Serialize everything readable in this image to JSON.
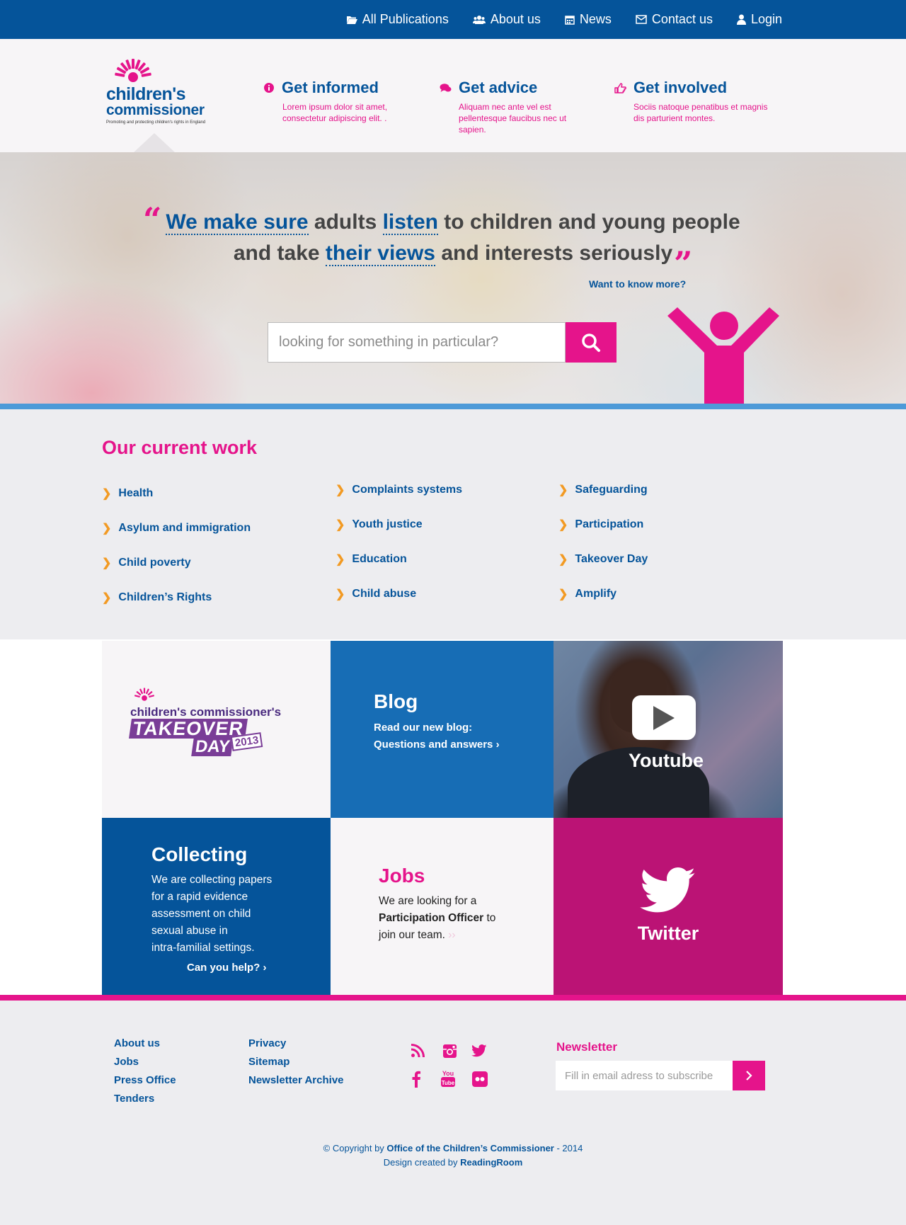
{
  "nav": {
    "items": [
      {
        "label": "All Publications",
        "icon": "folder-open-icon"
      },
      {
        "label": "About us",
        "icon": "users-icon"
      },
      {
        "label": "News",
        "icon": "calendar-icon"
      },
      {
        "label": "Contact us",
        "icon": "envelope-icon"
      },
      {
        "label": "Login",
        "icon": "user-icon"
      }
    ]
  },
  "logo": {
    "line1": "children's",
    "line2": "commissioner",
    "tagline": "Promoting and protecting children's rights in England"
  },
  "header": {
    "columns": [
      {
        "title": "Get informed",
        "icon": "info-circle-icon",
        "text": "Lorem ipsum dolor sit amet, consectetur adipiscing elit. ."
      },
      {
        "title": "Get advice",
        "icon": "comments-icon",
        "text": "Aliquam nec ante vel est pellentesque faucibus nec ut sapien."
      },
      {
        "title": "Get involved",
        "icon": "hand-pointer-icon",
        "text": "Sociis natoque penatibus et magnis dis parturient montes."
      }
    ]
  },
  "hero": {
    "quote": {
      "l1_hl1": "We make sure",
      "l1_t1": " adults ",
      "l1_hl2": "listen",
      "l1_t2": " to children and young people",
      "l2_t1": "and take ",
      "l2_hl1": "their views",
      "l2_t2": " and interests seriously"
    },
    "want_more": "Want to know more?",
    "search_placeholder": "looking for something in particular?"
  },
  "work": {
    "title": "Our current work",
    "columns": [
      [
        "Health",
        "Asylum and immigration",
        "Child poverty",
        "Children’s Rights"
      ],
      [
        "Complaints systems",
        "Youth justice",
        "Education",
        "Child abuse"
      ],
      [
        "Safeguarding",
        "Participation",
        "Takeover Day",
        "Amplify"
      ]
    ]
  },
  "tiles": {
    "takeover": {
      "line1": "children's commissioner's",
      "line2": "TAKEOVER",
      "line3": "DAY",
      "year": "2013"
    },
    "blog": {
      "title": "Blog",
      "line1": "Read our new blog:",
      "line2": "Questions and answers"
    },
    "youtube": {
      "label": "Youtube"
    },
    "collecting": {
      "title": "Collecting",
      "text": [
        "We are collecting papers",
        "for a rapid evidence",
        "assessment on child",
        "sexual abuse in",
        "intra-familial settings."
      ],
      "link": "Can you help?"
    },
    "jobs": {
      "title": "Jobs",
      "t1": "We are looking for a",
      "bold": "Participation Officer",
      "t2": " to",
      "t3": "join our team."
    },
    "twitter": {
      "label": "Twitter"
    }
  },
  "footer": {
    "col1": [
      "About us",
      "Jobs",
      "Press Office",
      "Tenders"
    ],
    "col2": [
      "Privacy",
      "Sitemap",
      "Newsletter Archive"
    ],
    "social": [
      "rss-icon",
      "instagram-icon",
      "twitter-icon",
      "facebook-icon",
      "youtube-icon",
      "flickr-icon"
    ],
    "newsletter": {
      "title": "Newsletter",
      "placeholder": "Fill in email adress to subscribe"
    },
    "copyright": {
      "prefix": "© Copyright by ",
      "org": "Office of the Children’s Commissioner",
      "suffix": " - 2014",
      "design_prefix": "Design created by ",
      "designer": "ReadingRoom"
    }
  },
  "colors": {
    "brand_blue": "#05549a",
    "brand_pink": "#e5148b",
    "accent_orange": "#f29a23",
    "hero_bar": "#4d9ad8",
    "twitter_tile": "#bb1375",
    "blog_tile": "#176db5"
  }
}
